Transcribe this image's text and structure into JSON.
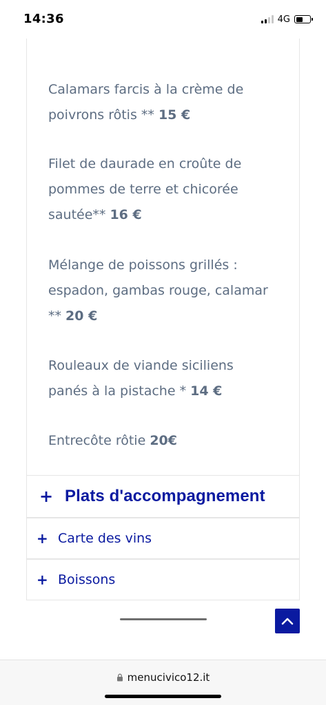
{
  "status_bar": {
    "time": "14:36",
    "network": "4G",
    "signal_bars_active": 2,
    "signal_bars_total": 4,
    "battery_level": 0.5
  },
  "menu": {
    "dishes": [
      {
        "name": "Calamars farcis à la crème de",
        "name_line2": "poivrons rôtis ** ",
        "price": "15 €"
      },
      {
        "name": "Filet de daurade en croûte de",
        "name_line2": "pommes de terre et chicorée",
        "name_line3": "sautée** ",
        "price": "16 €"
      },
      {
        "name": "Mélange de poissons grillés :",
        "name_line2": "espadon, gambas rouge, calamar",
        "name_line3": "** ",
        "price": "20 €"
      },
      {
        "name": "Rouleaux de viande siciliens",
        "name_line2": "panés à la pistache * ",
        "price": "14 €"
      },
      {
        "name": "Entrecôte rôtie ",
        "price": "20€"
      }
    ]
  },
  "accordion": {
    "sides": {
      "icon": "plus-icon",
      "label": "Plats d'accompagnement"
    },
    "wines": {
      "icon": "plus-icon",
      "label": "Carte des vins"
    },
    "drinks": {
      "icon": "plus-icon",
      "label": "Boissons"
    }
  },
  "back_to_top": {
    "icon": "chevron-up-icon"
  },
  "browser": {
    "url": "menucivico12.it",
    "icon": "lock-icon"
  },
  "colors": {
    "accent": "#0a1aa0",
    "text": "#5d6d82",
    "border": "#e6e6e6"
  }
}
